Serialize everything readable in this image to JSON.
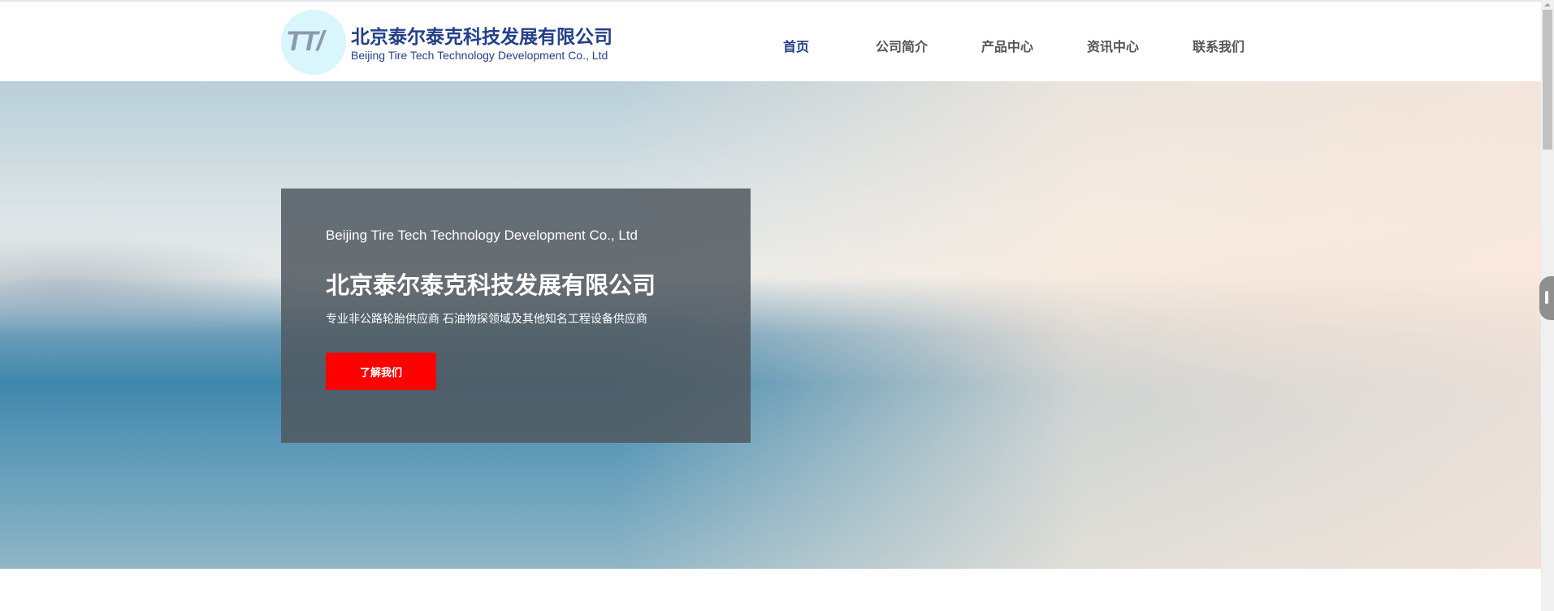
{
  "header": {
    "company_cn": "北京泰尔泰克科技发展有限公司",
    "company_en": "Beijing Tire Tech Technology Development Co., Ltd",
    "logo_text": "TT"
  },
  "nav": [
    {
      "label": "首页"
    },
    {
      "label": "公司简介"
    },
    {
      "label": "产品中心"
    },
    {
      "label": "资讯中心"
    },
    {
      "label": "联系我们"
    }
  ],
  "hero": {
    "subtitle_en": "Beijing Tire Tech Technology Development Co., Ltd",
    "title": "北京泰尔泰克科技发展有限公司",
    "description": "专业非公路轮胎供应商 石油物探领域及其他知名工程设备供应商",
    "button": "了解我们",
    "button_color": "#ff0000"
  }
}
